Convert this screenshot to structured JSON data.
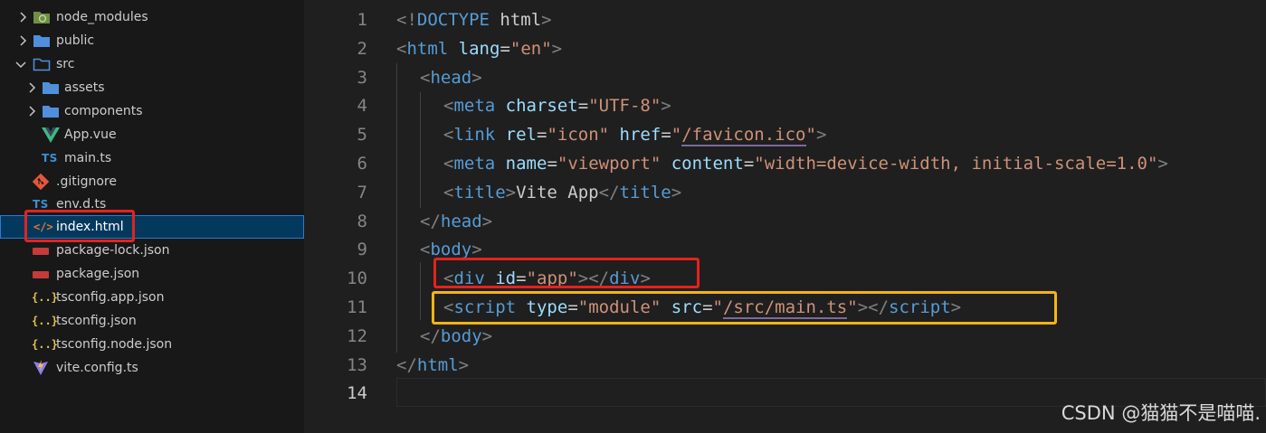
{
  "explorer": {
    "items": [
      {
        "label": "node_modules",
        "kind": "folder",
        "icon": "folder-node-icon",
        "expanded": false
      },
      {
        "label": "public",
        "kind": "folder",
        "icon": "folder-icon",
        "expanded": false
      },
      {
        "label": "src",
        "kind": "folder",
        "icon": "folder-open-icon",
        "expanded": true
      },
      {
        "label": "assets",
        "kind": "folder",
        "icon": "folder-icon",
        "expanded": false
      },
      {
        "label": "components",
        "kind": "folder",
        "icon": "folder-icon",
        "expanded": false
      },
      {
        "label": "App.vue",
        "kind": "file",
        "icon": "vue-icon"
      },
      {
        "label": "main.ts",
        "kind": "file",
        "icon": "typescript-icon",
        "badge": "TS"
      },
      {
        "label": ".gitignore",
        "kind": "file",
        "icon": "git-icon"
      },
      {
        "label": "env.d.ts",
        "kind": "file",
        "icon": "typescript-icon",
        "badge": "TS"
      },
      {
        "label": "index.html",
        "kind": "file",
        "icon": "html-icon",
        "badge": "</>",
        "selected": true
      },
      {
        "label": "package-lock.json",
        "kind": "file",
        "icon": "npm-icon"
      },
      {
        "label": "package.json",
        "kind": "file",
        "icon": "npm-icon"
      },
      {
        "label": "tsconfig.app.json",
        "kind": "file",
        "icon": "json-icon",
        "badge": "{..}"
      },
      {
        "label": "tsconfig.json",
        "kind": "file",
        "icon": "json-icon",
        "badge": "{..}"
      },
      {
        "label": "tsconfig.node.json",
        "kind": "file",
        "icon": "json-icon",
        "badge": "{..}"
      },
      {
        "label": "vite.config.ts",
        "kind": "file",
        "icon": "vite-icon"
      }
    ]
  },
  "editor": {
    "active_line": 14,
    "lines": [
      {
        "n": "1",
        "tokens": [
          [
            "punct",
            "<!"
          ],
          [
            "doctype",
            "DOCTYPE"
          ],
          [
            "text",
            " html"
          ],
          [
            "punct",
            ">"
          ]
        ]
      },
      {
        "n": "2",
        "tokens": [
          [
            "punct",
            "<"
          ],
          [
            "tag",
            "html"
          ],
          [
            "text",
            " "
          ],
          [
            "attr",
            "lang"
          ],
          [
            "eq",
            "="
          ],
          [
            "str",
            "\"en\""
          ],
          [
            "punct",
            ">"
          ]
        ]
      },
      {
        "n": "3",
        "tokens": [
          [
            "punct",
            "<"
          ],
          [
            "tag",
            "head"
          ],
          [
            "punct",
            ">"
          ]
        ]
      },
      {
        "n": "4",
        "tokens": [
          [
            "punct",
            "<"
          ],
          [
            "tag",
            "meta"
          ],
          [
            "text",
            " "
          ],
          [
            "attr",
            "charset"
          ],
          [
            "eq",
            "="
          ],
          [
            "str",
            "\"UTF-8\""
          ],
          [
            "punct",
            ">"
          ]
        ]
      },
      {
        "n": "5",
        "tokens": [
          [
            "punct",
            "<"
          ],
          [
            "tag",
            "link"
          ],
          [
            "text",
            " "
          ],
          [
            "attr",
            "rel"
          ],
          [
            "eq",
            "="
          ],
          [
            "str",
            "\"icon\""
          ],
          [
            "text",
            " "
          ],
          [
            "attr",
            "href"
          ],
          [
            "eq",
            "="
          ],
          [
            "str",
            "\""
          ],
          [
            "link",
            "/favicon.ico"
          ],
          [
            "str",
            "\""
          ],
          [
            "punct",
            ">"
          ]
        ]
      },
      {
        "n": "6",
        "tokens": [
          [
            "punct",
            "<"
          ],
          [
            "tag",
            "meta"
          ],
          [
            "text",
            " "
          ],
          [
            "attr",
            "name"
          ],
          [
            "eq",
            "="
          ],
          [
            "str",
            "\"viewport\""
          ],
          [
            "text",
            " "
          ],
          [
            "attr",
            "content"
          ],
          [
            "eq",
            "="
          ],
          [
            "str",
            "\"width=device-width, initial-scale=1.0\""
          ],
          [
            "punct",
            ">"
          ]
        ]
      },
      {
        "n": "7",
        "tokens": [
          [
            "punct",
            "<"
          ],
          [
            "tag",
            "title"
          ],
          [
            "punct",
            ">"
          ],
          [
            "text",
            "Vite App"
          ],
          [
            "punct",
            "</"
          ],
          [
            "tag",
            "title"
          ],
          [
            "punct",
            ">"
          ]
        ]
      },
      {
        "n": "8",
        "tokens": [
          [
            "punct",
            "</"
          ],
          [
            "tag",
            "head"
          ],
          [
            "punct",
            ">"
          ]
        ]
      },
      {
        "n": "9",
        "tokens": [
          [
            "punct",
            "<"
          ],
          [
            "tag",
            "body"
          ],
          [
            "punct",
            ">"
          ]
        ]
      },
      {
        "n": "10",
        "tokens": [
          [
            "punct",
            "<"
          ],
          [
            "tag",
            "div"
          ],
          [
            "text",
            " "
          ],
          [
            "attr",
            "id"
          ],
          [
            "eq",
            "="
          ],
          [
            "str",
            "\"app\""
          ],
          [
            "punct",
            "></"
          ],
          [
            "tag",
            "div"
          ],
          [
            "punct",
            ">"
          ]
        ]
      },
      {
        "n": "11",
        "tokens": [
          [
            "punct",
            "<"
          ],
          [
            "tag",
            "script"
          ],
          [
            "text",
            " "
          ],
          [
            "attr",
            "type"
          ],
          [
            "eq",
            "="
          ],
          [
            "str",
            "\"module\""
          ],
          [
            "text",
            " "
          ],
          [
            "attr",
            "src"
          ],
          [
            "eq",
            "="
          ],
          [
            "str",
            "\""
          ],
          [
            "link",
            "/src/main.ts"
          ],
          [
            "str",
            "\""
          ],
          [
            "punct",
            "></"
          ],
          [
            "tag",
            "script"
          ],
          [
            "punct",
            ">"
          ]
        ]
      },
      {
        "n": "12",
        "tokens": [
          [
            "punct",
            "</"
          ],
          [
            "tag",
            "body"
          ],
          [
            "punct",
            ">"
          ]
        ]
      },
      {
        "n": "13",
        "tokens": [
          [
            "punct",
            "</"
          ],
          [
            "tag",
            "html"
          ],
          [
            "punct",
            ">"
          ]
        ]
      },
      {
        "n": "14",
        "tokens": []
      }
    ]
  },
  "annotations": {
    "red_color": "#e3231f",
    "yellow_color": "#f4b414"
  },
  "watermark": "CSDN @猫猫不是喵喵."
}
